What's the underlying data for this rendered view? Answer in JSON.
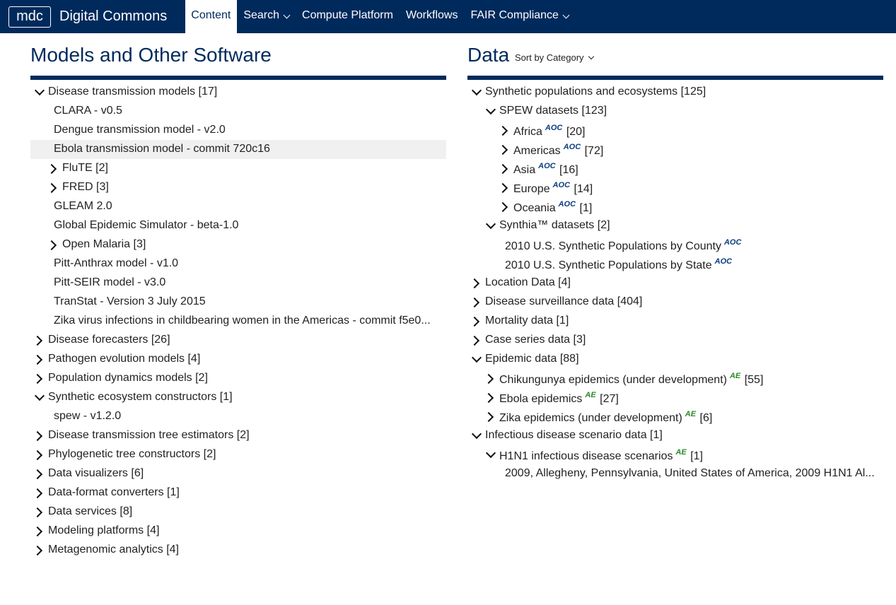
{
  "nav": {
    "logo": "mdc",
    "brand": "Digital Commons",
    "items": [
      {
        "label": "Content",
        "active": true,
        "dropdown": false
      },
      {
        "label": "Search",
        "active": false,
        "dropdown": true
      },
      {
        "label": "Compute Platform",
        "active": false,
        "dropdown": false
      },
      {
        "label": "Workflows",
        "active": false,
        "dropdown": false
      },
      {
        "label": "FAIR Compliance",
        "active": false,
        "dropdown": true
      }
    ]
  },
  "left": {
    "title": "Models and Other Software",
    "tree": [
      {
        "label": "Disease transmission models [17]",
        "level": 0,
        "arrow": "down"
      },
      {
        "label": "CLARA - v0.5",
        "level": 0.5,
        "arrow": null
      },
      {
        "label": "Dengue transmission model - v2.0",
        "level": 0.5,
        "arrow": null
      },
      {
        "label": "Ebola transmission model - commit 720c16",
        "level": 0.5,
        "arrow": null,
        "highlight": true
      },
      {
        "label": "FluTE [2]",
        "level": 1,
        "arrow": "right"
      },
      {
        "label": "FRED [3]",
        "level": 1,
        "arrow": "right"
      },
      {
        "label": "GLEAM 2.0",
        "level": 0.5,
        "arrow": null
      },
      {
        "label": "Global Epidemic Simulator - beta-1.0",
        "level": 0.5,
        "arrow": null
      },
      {
        "label": "Open Malaria [3]",
        "level": 1,
        "arrow": "right"
      },
      {
        "label": "Pitt-Anthrax model - v1.0",
        "level": 0.5,
        "arrow": null
      },
      {
        "label": "Pitt-SEIR model - v3.0",
        "level": 0.5,
        "arrow": null
      },
      {
        "label": "TranStat - Version 3 July 2015",
        "level": 0.5,
        "arrow": null
      },
      {
        "label": "Zika virus infections in childbearing women in the Americas - commit f5e0...",
        "level": 0.5,
        "arrow": null
      },
      {
        "label": "Disease forecasters [26]",
        "level": 0,
        "arrow": "right"
      },
      {
        "label": "Pathogen evolution models [4]",
        "level": 0,
        "arrow": "right"
      },
      {
        "label": "Population dynamics models [2]",
        "level": 0,
        "arrow": "right"
      },
      {
        "label": "Synthetic ecosystem constructors [1]",
        "level": 0,
        "arrow": "down"
      },
      {
        "label": "spew - v1.2.0",
        "level": 0.5,
        "arrow": null
      },
      {
        "label": "Disease transmission tree estimators [2]",
        "level": 0,
        "arrow": "right"
      },
      {
        "label": "Phylogenetic tree constructors [2]",
        "level": 0,
        "arrow": "right"
      },
      {
        "label": "Data visualizers [6]",
        "level": 0,
        "arrow": "right"
      },
      {
        "label": "Data-format converters [1]",
        "level": 0,
        "arrow": "right"
      },
      {
        "label": "Data services [8]",
        "level": 0,
        "arrow": "right"
      },
      {
        "label": "Modeling platforms [4]",
        "level": 0,
        "arrow": "right"
      },
      {
        "label": "Metagenomic analytics [4]",
        "level": 0,
        "arrow": "right"
      }
    ]
  },
  "right": {
    "title": "Data",
    "sort_label": "Sort by Category",
    "tree": [
      {
        "label": "Synthetic populations and ecosystems [125]",
        "level": 0,
        "arrow": "down"
      },
      {
        "label": "SPEW datasets [123]",
        "level": 1,
        "arrow": "down"
      },
      {
        "label": "Africa",
        "badge": "AOC",
        "count": "[20]",
        "level": 2,
        "arrow": "right"
      },
      {
        "label": "Americas",
        "badge": "AOC",
        "count": "[72]",
        "level": 2,
        "arrow": "right"
      },
      {
        "label": "Asia",
        "badge": "AOC",
        "count": "[16]",
        "level": 2,
        "arrow": "right"
      },
      {
        "label": "Europe",
        "badge": "AOC",
        "count": "[14]",
        "level": 2,
        "arrow": "right"
      },
      {
        "label": "Oceania",
        "badge": "AOC",
        "count": "[1]",
        "level": 2,
        "arrow": "right"
      },
      {
        "label": "Synthia™ datasets [2]",
        "level": 1,
        "arrow": "down"
      },
      {
        "label": "2010 U.S. Synthetic Populations by County",
        "badge": "AOC",
        "level": 1.5,
        "arrow": null
      },
      {
        "label": "2010 U.S. Synthetic Populations by State",
        "badge": "AOC",
        "level": 1.5,
        "arrow": null
      },
      {
        "label": "Location Data [4]",
        "level": 0,
        "arrow": "right"
      },
      {
        "label": "Disease surveillance data [404]",
        "level": 0,
        "arrow": "right"
      },
      {
        "label": "Mortality data [1]",
        "level": 0,
        "arrow": "right"
      },
      {
        "label": "Case series data [3]",
        "level": 0,
        "arrow": "right"
      },
      {
        "label": "Epidemic data [88]",
        "level": 0,
        "arrow": "down"
      },
      {
        "label": "Chikungunya epidemics (under development)",
        "badge": "AE",
        "count": "[55]",
        "level": 1,
        "arrow": "right"
      },
      {
        "label": "Ebola epidemics",
        "badge": "AE",
        "count": "[27]",
        "level": 1,
        "arrow": "right"
      },
      {
        "label": "Zika epidemics (under development)",
        "badge": "AE",
        "count": "[6]",
        "level": 1,
        "arrow": "right"
      },
      {
        "label": "Infectious disease scenario data [1]",
        "level": 0,
        "arrow": "down"
      },
      {
        "label": "H1N1 infectious disease scenarios",
        "badge": "AE",
        "count": "[1]",
        "level": 1,
        "arrow": "down"
      },
      {
        "label": "2009, Allegheny, Pennsylvania, United States of America, 2009 H1N1 Al...",
        "level": 1.5,
        "arrow": null
      }
    ]
  }
}
